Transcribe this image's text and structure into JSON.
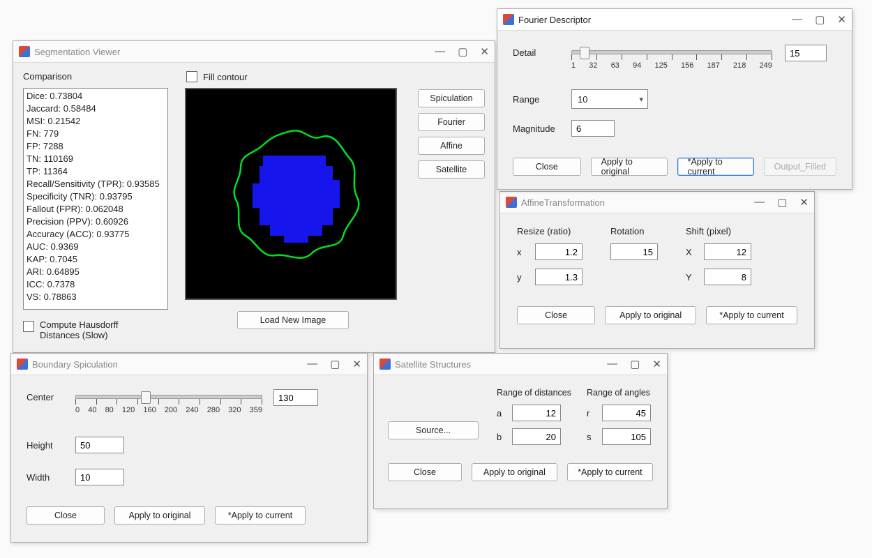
{
  "segviewer": {
    "title": "Segmentation Viewer",
    "comparison_label": "Comparison",
    "fill_contour_label": "Fill contour",
    "hausdorff_label_line1": "Compute Hausdorff",
    "hausdorff_label_line2": "Distances (Slow)",
    "load_image_btn": "Load New Image",
    "sidebtns": {
      "spiculation": "Spiculation",
      "fourier": "Fourier",
      "affine": "Affine",
      "satellite": "Satellite"
    },
    "metrics": [
      "Dice: 0.73804",
      "Jaccard: 0.58484",
      "MSI: 0.21542",
      "FN: 779",
      "FP: 7288",
      "TN: 110169",
      "TP: 11364",
      "Recall/Sensitivity (TPR): 0.93585",
      "Specificity (TNR): 0.93795",
      "Fallout (FPR): 0.062048",
      "Precision (PPV): 0.60926",
      "Accuracy (ACC): 0.93775",
      "AUC: 0.9369",
      "KAP: 0.7045",
      "ARI: 0.64895",
      "ICC: 0.7378",
      "VS: 0.78863"
    ]
  },
  "fourier": {
    "title": "Fourier Descriptor",
    "detail_label": "Detail",
    "range_label": "Range",
    "magnitude_label": "Magnitude",
    "detail_value": "15",
    "range_value": "10",
    "magnitude_value": "6",
    "ticklabels": [
      "1",
      "32",
      "63",
      "94",
      "125",
      "156",
      "187",
      "218",
      "249"
    ],
    "btns": {
      "close": "Close",
      "apply_orig": "Apply to original",
      "apply_cur": "*Apply to current",
      "output": "Output_Filled"
    }
  },
  "affine": {
    "title": "AffineTransformation",
    "resize_label": "Resize (ratio)",
    "rotation_label": "Rotation",
    "shift_label": "Shift (pixel)",
    "x": "x",
    "y": "y",
    "X": "X",
    "Y": "Y",
    "resize_x": "1.2",
    "resize_y": "1.3",
    "rotation": "15",
    "shift_x": "12",
    "shift_y": "8",
    "btns": {
      "close": "Close",
      "apply_orig": "Apply to original",
      "apply_cur": "*Apply to current"
    }
  },
  "spiculation": {
    "title": "Boundary Spiculation",
    "center_label": "Center",
    "height_label": "Height",
    "width_label": "Width",
    "center_value": "130",
    "height_value": "50",
    "width_value": "10",
    "ticklabels": [
      "0",
      "40",
      "80",
      "120",
      "160",
      "200",
      "240",
      "280",
      "320",
      "359"
    ],
    "btns": {
      "close": "Close",
      "apply_orig": "Apply to original",
      "apply_cur": "*Apply to current"
    }
  },
  "satellite": {
    "title": "Satellite Structures",
    "source_btn": "Source...",
    "dist_label": "Range of distances",
    "ang_label": "Range of angles",
    "a": "a",
    "b": "b",
    "r": "r",
    "s": "s",
    "a_val": "12",
    "b_val": "20",
    "r_val": "45",
    "s_val": "105",
    "btns": {
      "close": "Close",
      "apply_orig": "Apply to original",
      "apply_cur": "*Apply to current"
    }
  }
}
